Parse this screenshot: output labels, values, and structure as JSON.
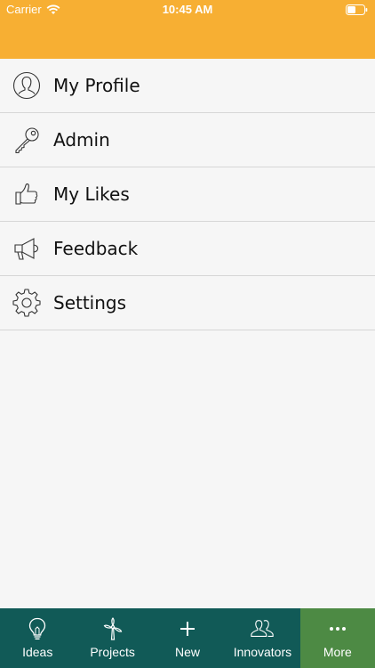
{
  "status_bar": {
    "carrier": "Carrier",
    "time": "10:45 AM"
  },
  "menu": {
    "items": [
      {
        "label": "My Profile",
        "icon": "user-icon"
      },
      {
        "label": "Admin",
        "icon": "key-icon"
      },
      {
        "label": "My Likes",
        "icon": "thumbs-up-icon"
      },
      {
        "label": "Feedback",
        "icon": "megaphone-icon"
      },
      {
        "label": "Settings",
        "icon": "gear-icon"
      }
    ]
  },
  "tabbar": {
    "items": [
      {
        "label": "Ideas",
        "icon": "lightbulb-icon"
      },
      {
        "label": "Projects",
        "icon": "wind-turbine-icon"
      },
      {
        "label": "New",
        "icon": "plus-icon"
      },
      {
        "label": "Innovators",
        "icon": "people-icon"
      },
      {
        "label": "More",
        "icon": "more-dots-icon",
        "active": true
      }
    ]
  },
  "colors": {
    "header": "#f7af33",
    "tabbar": "#115a57",
    "tab_active": "#4d8a44",
    "background": "#f6f6f6"
  }
}
